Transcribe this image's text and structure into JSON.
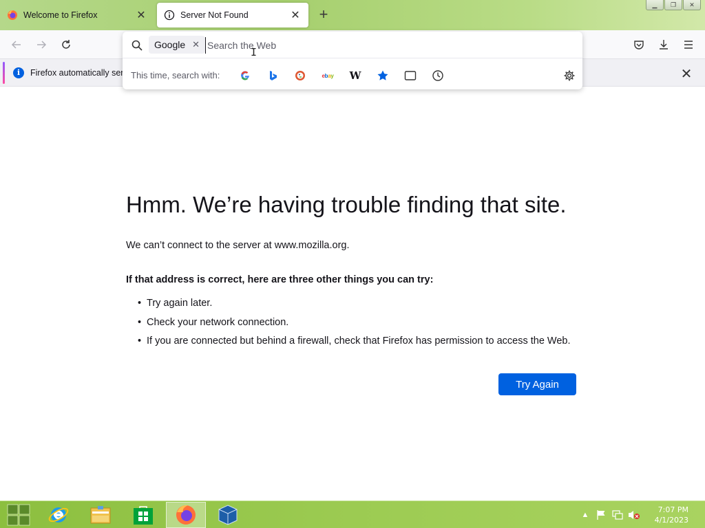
{
  "browser": {
    "tabs": [
      {
        "label": "Welcome to Firefox",
        "active": false,
        "icon": "firefox-icon"
      },
      {
        "label": "Server Not Found",
        "active": true,
        "icon": "info-circle-icon"
      }
    ],
    "new_tab_icon": "plus-icon",
    "window_controls": [
      "minimize-icon",
      "restore-icon",
      "close-icon"
    ]
  },
  "nav": {
    "back_icon": "back-arrow-icon",
    "forward_icon": "forward-arrow-icon",
    "reload_icon": "reload-icon",
    "pocket_icon": "pocket-icon",
    "downloads_icon": "download-icon",
    "menu_icon": "hamburger-menu-icon"
  },
  "notification": {
    "text": "Firefox automatically sends some data to Mozilla",
    "close_icon": "close-icon"
  },
  "urlbar": {
    "engine_chip": "Google",
    "placeholder": "Search the Web",
    "search_with_label": "This time, search with:",
    "engines": [
      {
        "name": "google",
        "icon": "google-icon"
      },
      {
        "name": "bing",
        "icon": "bing-icon"
      },
      {
        "name": "duckduckgo",
        "icon": "duckduckgo-icon"
      },
      {
        "name": "ebay",
        "icon": "ebay-icon"
      },
      {
        "name": "wikipedia",
        "icon": "wikipedia-icon"
      },
      {
        "name": "bookmarks",
        "icon": "star-icon"
      },
      {
        "name": "tabs",
        "icon": "tab-icon"
      },
      {
        "name": "history",
        "icon": "clock-icon"
      }
    ],
    "settings_icon": "gear-icon"
  },
  "error_page": {
    "title": "Hmm. We’re having trouble finding that site.",
    "description": "We can’t connect to the server at www.mozilla.org.",
    "suggestions_heading": "If that address is correct, here are three other things you can try:",
    "suggestions": [
      "Try again later.",
      "Check your network connection.",
      "If you are connected but behind a firewall, check that Firefox has permission to access the Web."
    ],
    "try_again_label": "Try Again"
  },
  "taskbar": {
    "items": [
      "start-icon",
      "internet-explorer-icon",
      "file-explorer-icon",
      "store-icon",
      "firefox-icon",
      "virtualbox-icon"
    ],
    "clock_time": "7:07 PM",
    "clock_date": "4/1/2023"
  },
  "colors": {
    "accent_blue": "#0061e0",
    "taskbar_green": "#9ccb52"
  }
}
